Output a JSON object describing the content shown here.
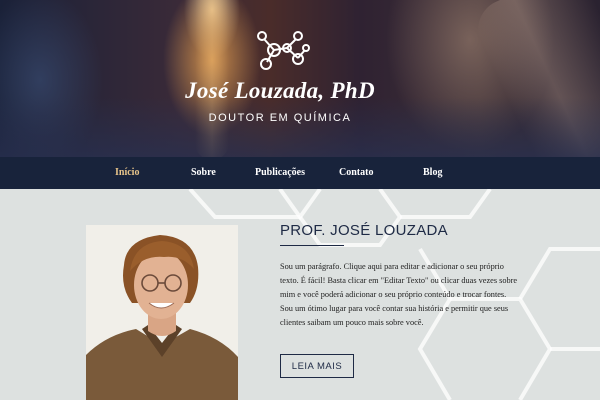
{
  "header": {
    "title": "José Louzada, PhD",
    "subtitle": "DOUTOR EM QUÍMICA",
    "logo_icon": "molecule-icon"
  },
  "nav": {
    "items": [
      {
        "label": "Início",
        "active": true
      },
      {
        "label": "Sobre",
        "active": false
      },
      {
        "label": "Publicações",
        "active": false
      },
      {
        "label": "Contato",
        "active": false
      },
      {
        "label": "Blog",
        "active": false
      }
    ]
  },
  "main": {
    "heading": "PROF. JOSÉ LOUZADA",
    "bio": "Sou um parágrafo. Clique aqui para editar e adicionar o seu próprio texto. É fácil! Basta clicar em \"Editar Texto\" ou clicar duas vezes sobre mim e você poderá adicionar o seu próprio conteúdo e trocar fontes. Sou um ótimo lugar para você contar sua história e permitir que seus clientes saibam um pouco mais sobre você.",
    "read_more_label": "LEIA MAIS"
  },
  "colors": {
    "nav_background": "#18233b",
    "active_nav": "#e7c48a",
    "page_background": "#dde1e0",
    "heading_text": "#1e2a45"
  }
}
